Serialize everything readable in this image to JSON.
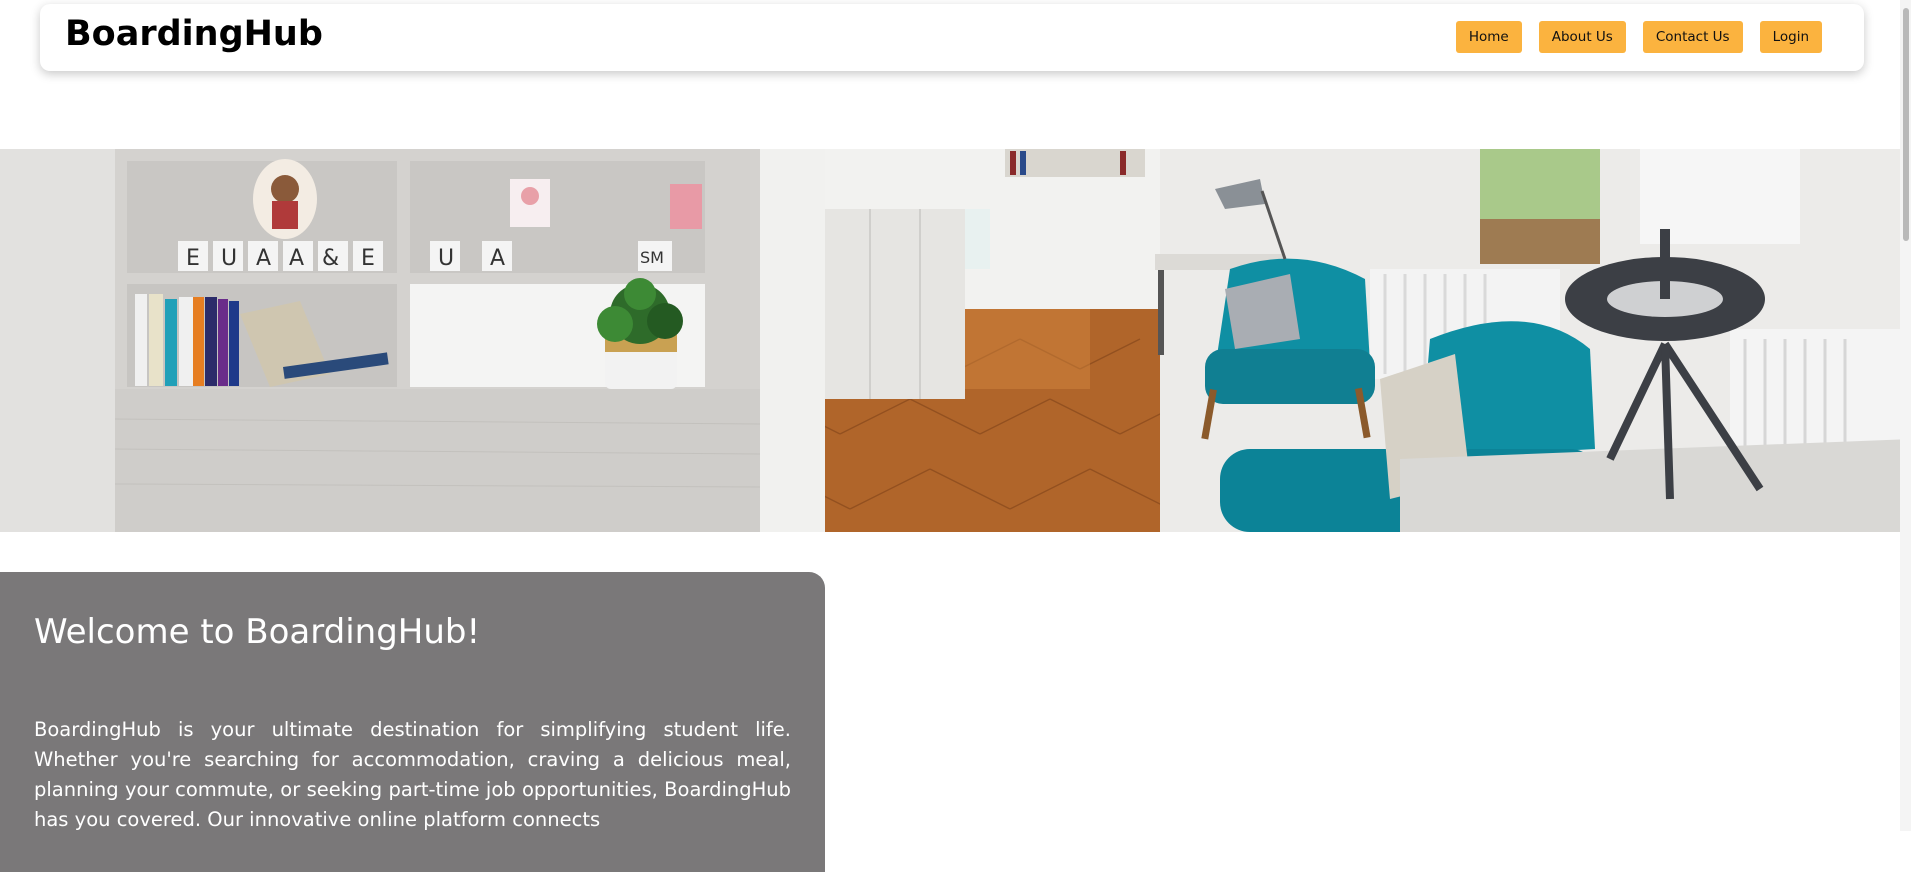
{
  "header": {
    "brand": "BoardingHub",
    "nav": [
      "Home",
      "About Us",
      "Contact Us",
      "Login"
    ]
  },
  "hero": {
    "image": "student-room-photo",
    "shelf_letters": [
      "E",
      "U",
      "A",
      "A",
      "&",
      "E",
      "U",
      "A",
      "SM"
    ]
  },
  "welcome": {
    "title": "Welcome to BoardingHub!",
    "body": "BoardingHub is your ultimate destination for simplifying student life. Whether you're searching for accommodation, craving a delicious meal, planning your commute, or seeking part-time job opportunities, BoardingHub has you covered. Our innovative online platform connects"
  },
  "colors": {
    "nav_button": "#fbb33f",
    "welcome_panel": "#7a7879",
    "chair_teal": "#0f8fa3",
    "floor_wood": "#b0652a"
  }
}
